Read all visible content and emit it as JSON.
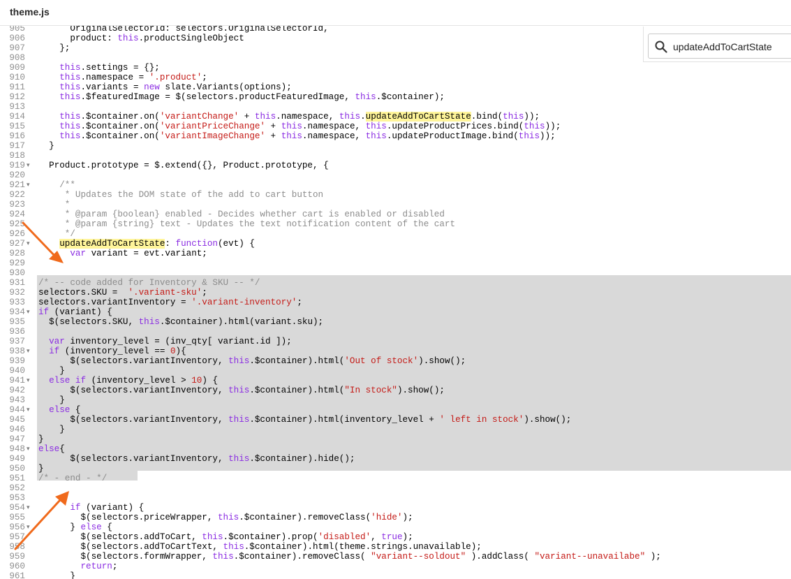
{
  "file": {
    "name": "theme.js"
  },
  "search": {
    "value": "updateAddToCartState"
  },
  "code_lines": [
    {
      "n": "905",
      "fold": false,
      "t": "      OriginalSelectorId: selectors.OriginalSelectorId,"
    },
    {
      "n": "906",
      "fold": false,
      "t": "      product: this.productSingleObject"
    },
    {
      "n": "907",
      "fold": false,
      "t": "    };"
    },
    {
      "n": "908",
      "fold": false,
      "t": ""
    },
    {
      "n": "909",
      "fold": false,
      "t": "    this.settings = {};"
    },
    {
      "n": "910",
      "fold": false,
      "t": "    this.namespace = '.product';"
    },
    {
      "n": "911",
      "fold": false,
      "t": "    this.variants = new slate.Variants(options);"
    },
    {
      "n": "912",
      "fold": false,
      "t": "    this.$featuredImage = $(selectors.productFeaturedImage, this.$container);"
    },
    {
      "n": "913",
      "fold": false,
      "t": ""
    },
    {
      "n": "914",
      "fold": false,
      "t": "    this.$container.on('variantChange' + this.namespace, this.updateAddToCartState.bind(this));"
    },
    {
      "n": "915",
      "fold": false,
      "t": "    this.$container.on('variantPriceChange' + this.namespace, this.updateProductPrices.bind(this));"
    },
    {
      "n": "916",
      "fold": false,
      "t": "    this.$container.on('variantImageChange' + this.namespace, this.updateProductImage.bind(this));"
    },
    {
      "n": "917",
      "fold": false,
      "t": "  }"
    },
    {
      "n": "918",
      "fold": false,
      "t": ""
    },
    {
      "n": "919",
      "fold": true,
      "t": "  Product.prototype = $.extend({}, Product.prototype, {"
    },
    {
      "n": "920",
      "fold": false,
      "t": ""
    },
    {
      "n": "921",
      "fold": true,
      "t": "    /**"
    },
    {
      "n": "922",
      "fold": false,
      "t": "     * Updates the DOM state of the add to cart button"
    },
    {
      "n": "923",
      "fold": false,
      "t": "     *"
    },
    {
      "n": "924",
      "fold": false,
      "t": "     * @param {boolean} enabled - Decides whether cart is enabled or disabled"
    },
    {
      "n": "925",
      "fold": false,
      "t": "     * @param {string} text - Updates the text notification content of the cart"
    },
    {
      "n": "926",
      "fold": false,
      "t": "     */"
    },
    {
      "n": "927",
      "fold": true,
      "t": "    updateAddToCartState: function(evt) {"
    },
    {
      "n": "928",
      "fold": false,
      "t": "      var variant = evt.variant;"
    },
    {
      "n": "929",
      "fold": false,
      "t": ""
    },
    {
      "n": "930",
      "fold": false,
      "t": ""
    },
    {
      "n": "931",
      "fold": false,
      "t": "/* -- code added for Inventory & SKU -- */"
    },
    {
      "n": "932",
      "fold": false,
      "t": "selectors.SKU =  '.variant-sku';"
    },
    {
      "n": "933",
      "fold": false,
      "t": "selectors.variantInventory = '.variant-inventory';"
    },
    {
      "n": "934",
      "fold": true,
      "t": "if (variant) {"
    },
    {
      "n": "935",
      "fold": false,
      "t": "  $(selectors.SKU, this.$container).html(variant.sku);"
    },
    {
      "n": "936",
      "fold": false,
      "t": ""
    },
    {
      "n": "937",
      "fold": false,
      "t": "  var inventory_level = (inv_qty[ variant.id ]);"
    },
    {
      "n": "938",
      "fold": true,
      "t": "  if (inventory_level == 0){"
    },
    {
      "n": "939",
      "fold": false,
      "t": "      $(selectors.variantInventory, this.$container).html('Out of stock').show();"
    },
    {
      "n": "940",
      "fold": false,
      "t": "    }"
    },
    {
      "n": "941",
      "fold": true,
      "t": "  else if (inventory_level > 10) {"
    },
    {
      "n": "942",
      "fold": false,
      "t": "      $(selectors.variantInventory, this.$container).html(\"In stock\").show();"
    },
    {
      "n": "943",
      "fold": false,
      "t": "    }"
    },
    {
      "n": "944",
      "fold": true,
      "t": "  else {"
    },
    {
      "n": "945",
      "fold": false,
      "t": "      $(selectors.variantInventory, this.$container).html(inventory_level + ' left in stock').show();"
    },
    {
      "n": "946",
      "fold": false,
      "t": "    }"
    },
    {
      "n": "947",
      "fold": false,
      "t": "}"
    },
    {
      "n": "948",
      "fold": true,
      "t": "else{"
    },
    {
      "n": "949",
      "fold": false,
      "t": "      $(selectors.variantInventory, this.$container).hide();"
    },
    {
      "n": "950",
      "fold": false,
      "t": "}"
    },
    {
      "n": "951",
      "fold": false,
      "t": "/* - end - */"
    },
    {
      "n": "952",
      "fold": false,
      "t": ""
    },
    {
      "n": "953",
      "fold": false,
      "t": ""
    },
    {
      "n": "954",
      "fold": true,
      "t": "      if (variant) {"
    },
    {
      "n": "955",
      "fold": false,
      "t": "        $(selectors.priceWrapper, this.$container).removeClass('hide');"
    },
    {
      "n": "956",
      "fold": true,
      "t": "      } else {"
    },
    {
      "n": "957",
      "fold": false,
      "t": "        $(selectors.addToCart, this.$container).prop('disabled', true);"
    },
    {
      "n": "958",
      "fold": false,
      "t": "        $(selectors.addToCartText, this.$container).html(theme.strings.unavailable);"
    },
    {
      "n": "959",
      "fold": false,
      "t": "        $(selectors.formWrapper, this.$container).removeClass( \"variant--soldout\" ).addClass( \"variant--unavailabe\" );"
    },
    {
      "n": "960",
      "fold": false,
      "t": "        return;"
    },
    {
      "n": "961",
      "fold": false,
      "t": "      }"
    }
  ],
  "colors": {
    "arrow": "#f06a1c",
    "selection": "#d9d9d9",
    "search_highlight": "#fff59a"
  }
}
